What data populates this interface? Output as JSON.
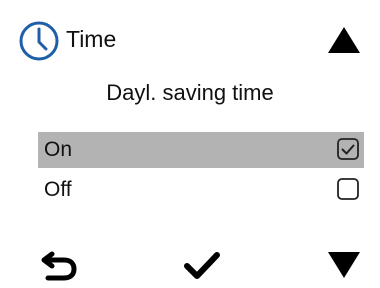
{
  "header": {
    "title": "Time",
    "icon": "clock-icon",
    "accent_color": "#1f5fa8"
  },
  "subtitle": "Dayl. saving time",
  "options": [
    {
      "label": "On",
      "checked": true,
      "selected": true
    },
    {
      "label": "Off",
      "checked": false,
      "selected": false
    }
  ],
  "footer": {
    "back_icon": "back-arrow-icon",
    "confirm_icon": "checkmark-icon",
    "scroll_down_icon": "triangle-down-icon"
  },
  "scroll_up_icon": "triangle-up-icon",
  "colors": {
    "selected_row": "#b3b3b3",
    "text": "#111111",
    "background": "#ffffff"
  }
}
